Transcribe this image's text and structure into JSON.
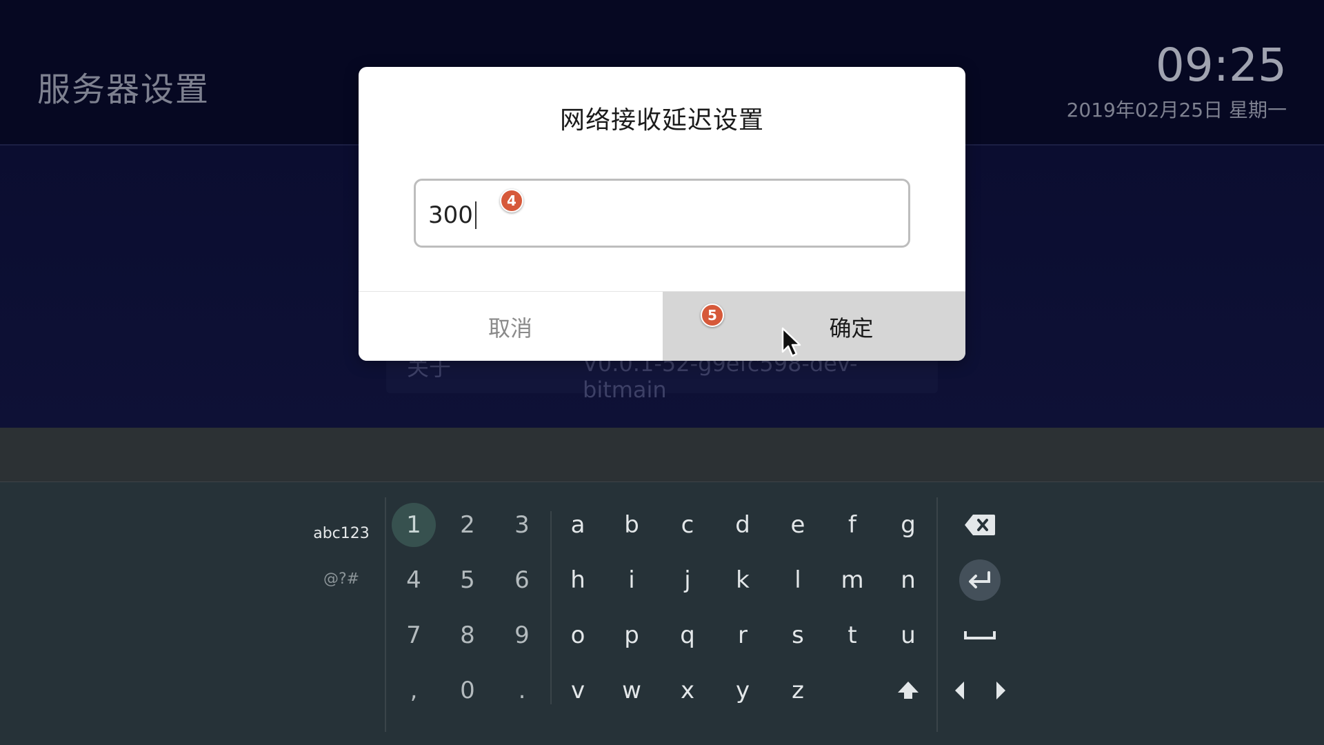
{
  "header": {
    "title": "服务器设置",
    "clock": "09:25",
    "date": "2019年02月25日  星期一"
  },
  "background_row": {
    "label": "关于",
    "value": "V0.0.1-52-g9efc598-dev-bitmain"
  },
  "dialog": {
    "title": "网络接收延迟设置",
    "input_value": "300",
    "cancel_label": "取消",
    "ok_label": "确定",
    "step_markers": [
      "4",
      "5"
    ]
  },
  "keyboard": {
    "modes": [
      "abc123",
      "@?#"
    ],
    "numpad": [
      [
        "1",
        "2",
        "3"
      ],
      [
        "4",
        "5",
        "6"
      ],
      [
        "7",
        "8",
        "9"
      ],
      [
        ",",
        "0",
        "."
      ]
    ],
    "letters": [
      [
        "a",
        "b",
        "c",
        "d",
        "e",
        "f",
        "g"
      ],
      [
        "h",
        "i",
        "j",
        "k",
        "l",
        "m",
        "n"
      ],
      [
        "o",
        "p",
        "q",
        "r",
        "s",
        "t",
        "u"
      ],
      [
        "v",
        "w",
        "x",
        "y",
        "z"
      ]
    ],
    "focused_key": "1",
    "function_icons": [
      "backspace-icon",
      "enter-icon",
      "space-icon",
      "shift-icon",
      "cursor-left-icon",
      "cursor-right-icon"
    ]
  },
  "colors": {
    "badge": "#d6593a",
    "keyboard_bg": "#263238",
    "focus": "#37514f",
    "ok_button_bg": "#d6d6d6"
  }
}
